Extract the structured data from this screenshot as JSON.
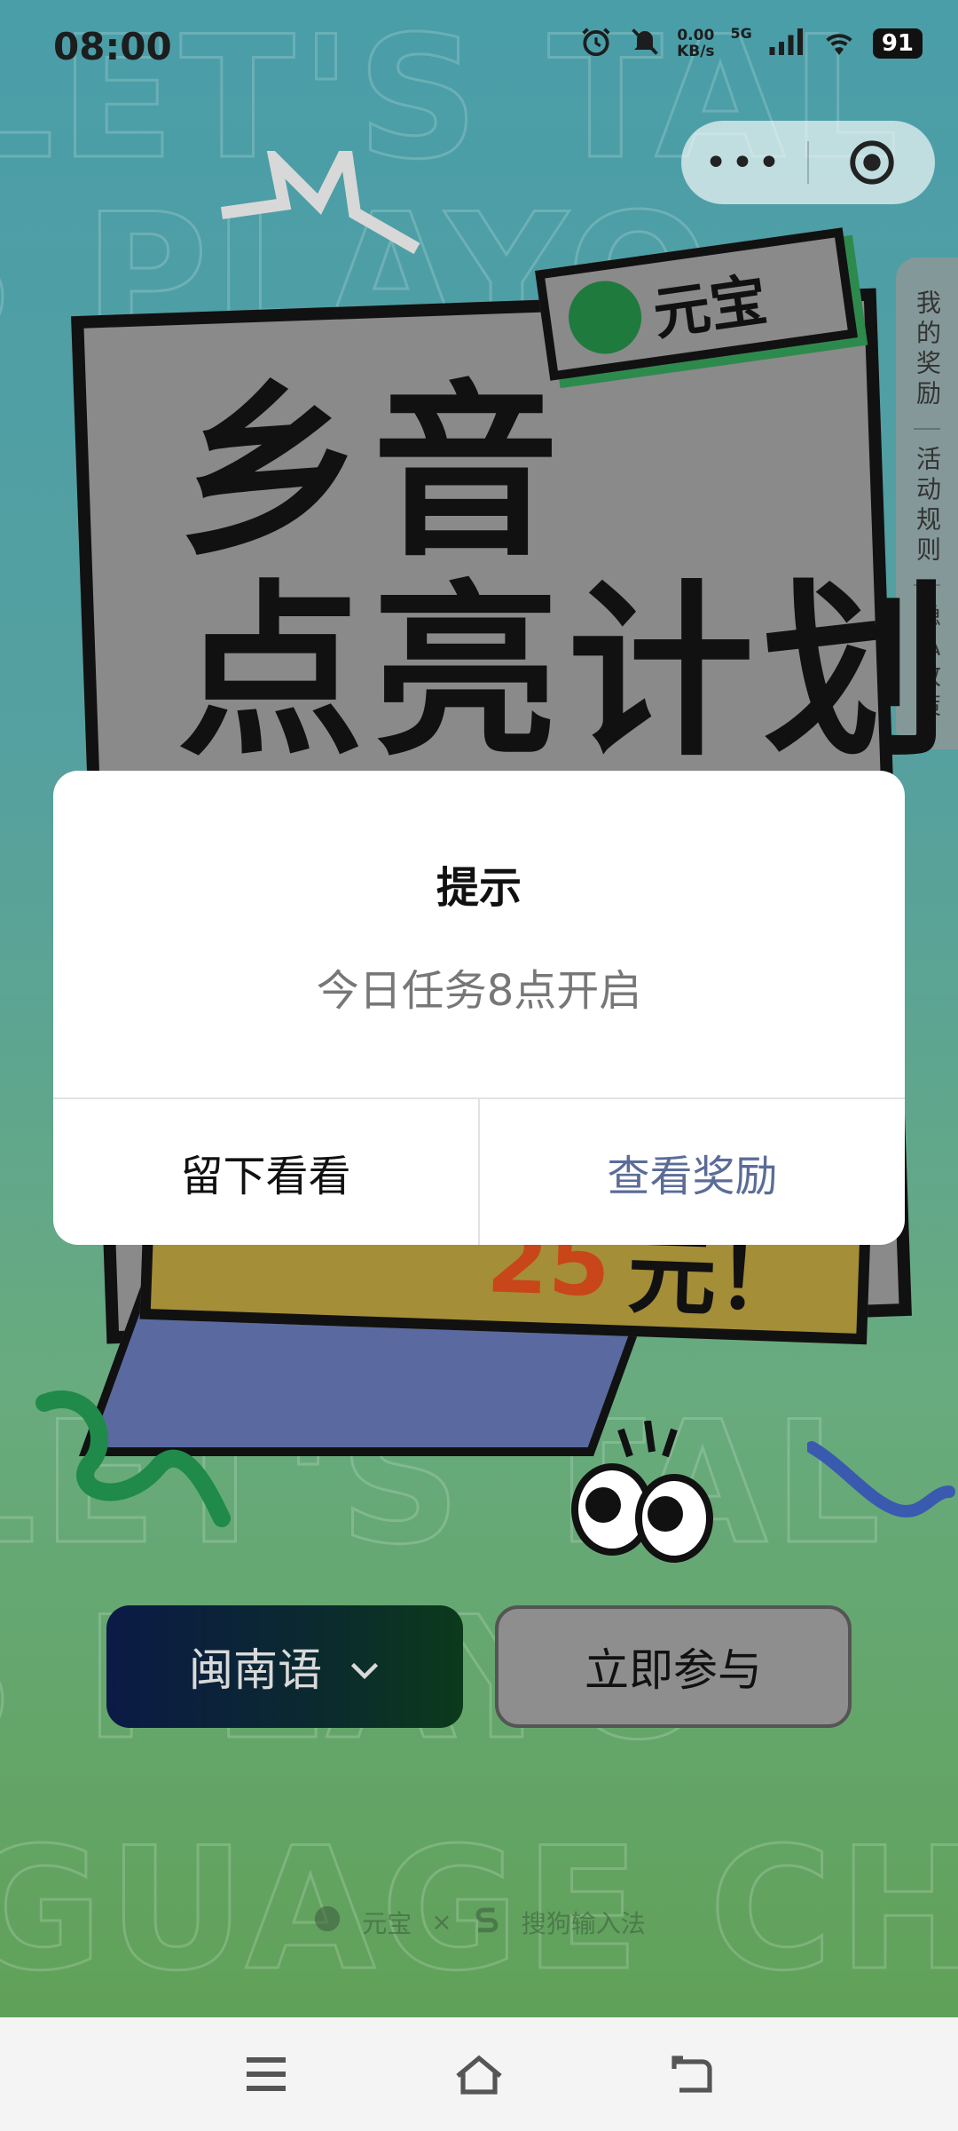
{
  "status_bar": {
    "time": "08:00",
    "net_speed_value": "0.00",
    "net_speed_unit": "KB/s",
    "network_type": "5G",
    "battery": "91"
  },
  "side_tab": {
    "items": [
      "我的奖励",
      "活动规则",
      "隐私政策"
    ]
  },
  "poster": {
    "title_line1": "乡音",
    "title_line2": "点亮计划",
    "bubble_brand": "元宝",
    "reward_amount": "25",
    "reward_suffix": "元！"
  },
  "dialog": {
    "title": "提示",
    "message": "今日任务8点开启",
    "left_button": "留下看看",
    "right_button": "查看奖励"
  },
  "actions": {
    "language_select": "闽南语",
    "join_button": "立即参与"
  },
  "footer": {
    "brand1": "元宝",
    "separator": "×",
    "brand2": "搜狗输入法"
  },
  "colors": {
    "dialog_accent": "#5b6c98",
    "bg_top": "#4a9ea8",
    "bg_bottom": "#5f9f52"
  }
}
